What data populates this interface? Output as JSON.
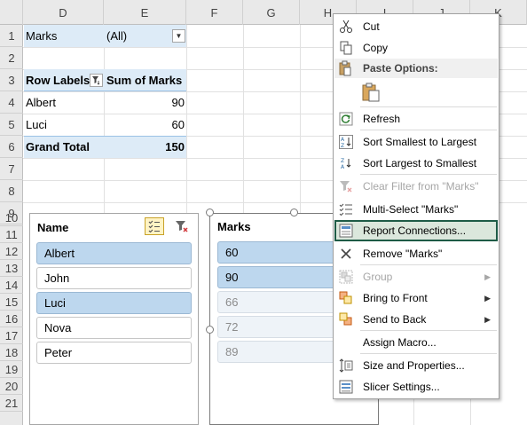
{
  "columns": [
    "D",
    "E",
    "F",
    "G",
    "H",
    "I",
    "J",
    "K"
  ],
  "rows": [
    "1",
    "2",
    "3",
    "4",
    "5",
    "6",
    "7",
    "8",
    "9",
    "10",
    "11",
    "12",
    "13",
    "14",
    "15",
    "16",
    "17",
    "18",
    "19",
    "20",
    "21"
  ],
  "pivot": {
    "filter_label": "Marks",
    "filter_value": "(All)",
    "row_labels_header": "Row Labels",
    "sum_header": "Sum of Marks",
    "rows": [
      {
        "name": "Albert",
        "value": "90"
      },
      {
        "name": "Luci",
        "value": "60"
      }
    ],
    "grand_total_label": "Grand Total",
    "grand_total_value": "150"
  },
  "slicer_name": {
    "title": "Name",
    "items": [
      {
        "label": "Albert",
        "state": "selected"
      },
      {
        "label": "John",
        "state": "normal"
      },
      {
        "label": "Luci",
        "state": "selected"
      },
      {
        "label": "Nova",
        "state": "normal"
      },
      {
        "label": "Peter",
        "state": "normal"
      }
    ]
  },
  "slicer_marks": {
    "title": "Marks",
    "items": [
      {
        "label": "60",
        "state": "selected"
      },
      {
        "label": "90",
        "state": "selected"
      },
      {
        "label": "66",
        "state": "dim"
      },
      {
        "label": "72",
        "state": "dim"
      },
      {
        "label": "89",
        "state": "dim"
      }
    ]
  },
  "context_menu": {
    "cut": "Cut",
    "copy": "Copy",
    "paste_options": "Paste Options:",
    "refresh": "Refresh",
    "sort_smallest": "Sort Smallest to Largest",
    "sort_largest": "Sort Largest to Smallest",
    "clear_filter": "Clear Filter from \"Marks\"",
    "multi_select": "Multi-Select \"Marks\"",
    "report_connections": "Report Connections...",
    "remove": "Remove \"Marks\"",
    "group": "Group",
    "bring_to_front": "Bring to Front",
    "send_to_back": "Send to Back",
    "assign_macro": "Assign Macro...",
    "size_properties": "Size and Properties...",
    "slicer_settings": "Slicer Settings..."
  },
  "colors": {
    "pivot_fill": "#ddebf7",
    "selected_item": "#bdd7ee",
    "highlight_outline": "#1e5b46",
    "highlight_fill": "#dbe7dc"
  }
}
